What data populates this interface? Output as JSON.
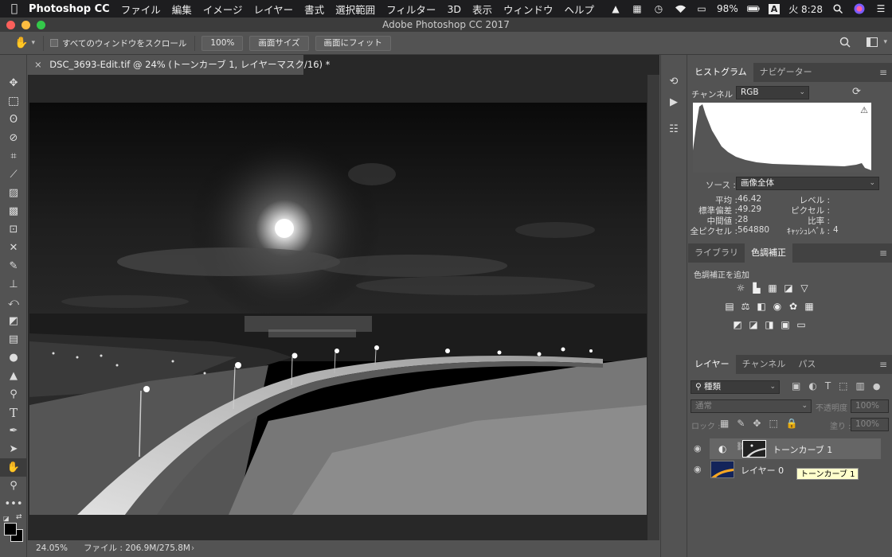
{
  "menubar": {
    "apple": "",
    "app_name": "Photoshop CC",
    "items": [
      "ファイル",
      "編集",
      "イメージ",
      "レイヤー",
      "書式",
      "選択範囲",
      "フィルター",
      "3D",
      "表示",
      "ウィンドウ",
      "ヘルプ"
    ],
    "battery": "98%",
    "input_method": "A",
    "clock": "火 8:28"
  },
  "window": {
    "title": "Adobe Photoshop CC 2017"
  },
  "options": {
    "scroll_all_label": "すべてのウィンドウをスクロール",
    "zoom_100": "100%",
    "fit_screen": "画面サイズ",
    "fill_screen": "画面にフィット"
  },
  "document": {
    "tab_title": "DSC_3693-Edit.tif @ 24% (トーンカーブ 1, レイヤーマスク/16) *",
    "close": "×"
  },
  "status": {
    "zoom": "24.05%",
    "file_size": "ファイル : 206.9M/275.8M",
    "arrow": "›"
  },
  "histogram_panel": {
    "tabs": [
      "ヒストグラム",
      "ナビゲーター"
    ],
    "channel_label": "チャンネル :",
    "channel_value": "RGB",
    "source_label": "ソース :",
    "source_value": "画像全体",
    "stats": {
      "mean_label": "平均 :",
      "mean": "46.42",
      "std_label": "標準偏差 :",
      "std": "49.29",
      "median_label": "中間値 :",
      "median": "28",
      "pixels_label": "全ピクセル :",
      "pixels": "564880",
      "level_label": "レベル :",
      "level": "",
      "count_label": "ピクセル :",
      "count": "",
      "percentile_label": "比率 :",
      "percentile": "",
      "cache_label": "ｷｬｯｼｭﾚﾍﾞﾙ :",
      "cache": "4"
    }
  },
  "adjust_panel": {
    "tabs": [
      "ライブラリ",
      "色調補正"
    ],
    "add_label": "色調補正を追加"
  },
  "layers_panel": {
    "tabs": [
      "レイヤー",
      "チャンネル",
      "パス"
    ],
    "filter_value": "種類",
    "blend_mode": "通常",
    "opacity_label": "不透明度 :",
    "opacity_value": "100%",
    "lock_label": "ロック :",
    "fill_label": "塗り :",
    "fill_value": "100%",
    "layers": [
      {
        "name": "トーンカーブ 1"
      },
      {
        "name": "レイヤー 0"
      }
    ],
    "tooltip": "トーンカーブ 1"
  }
}
